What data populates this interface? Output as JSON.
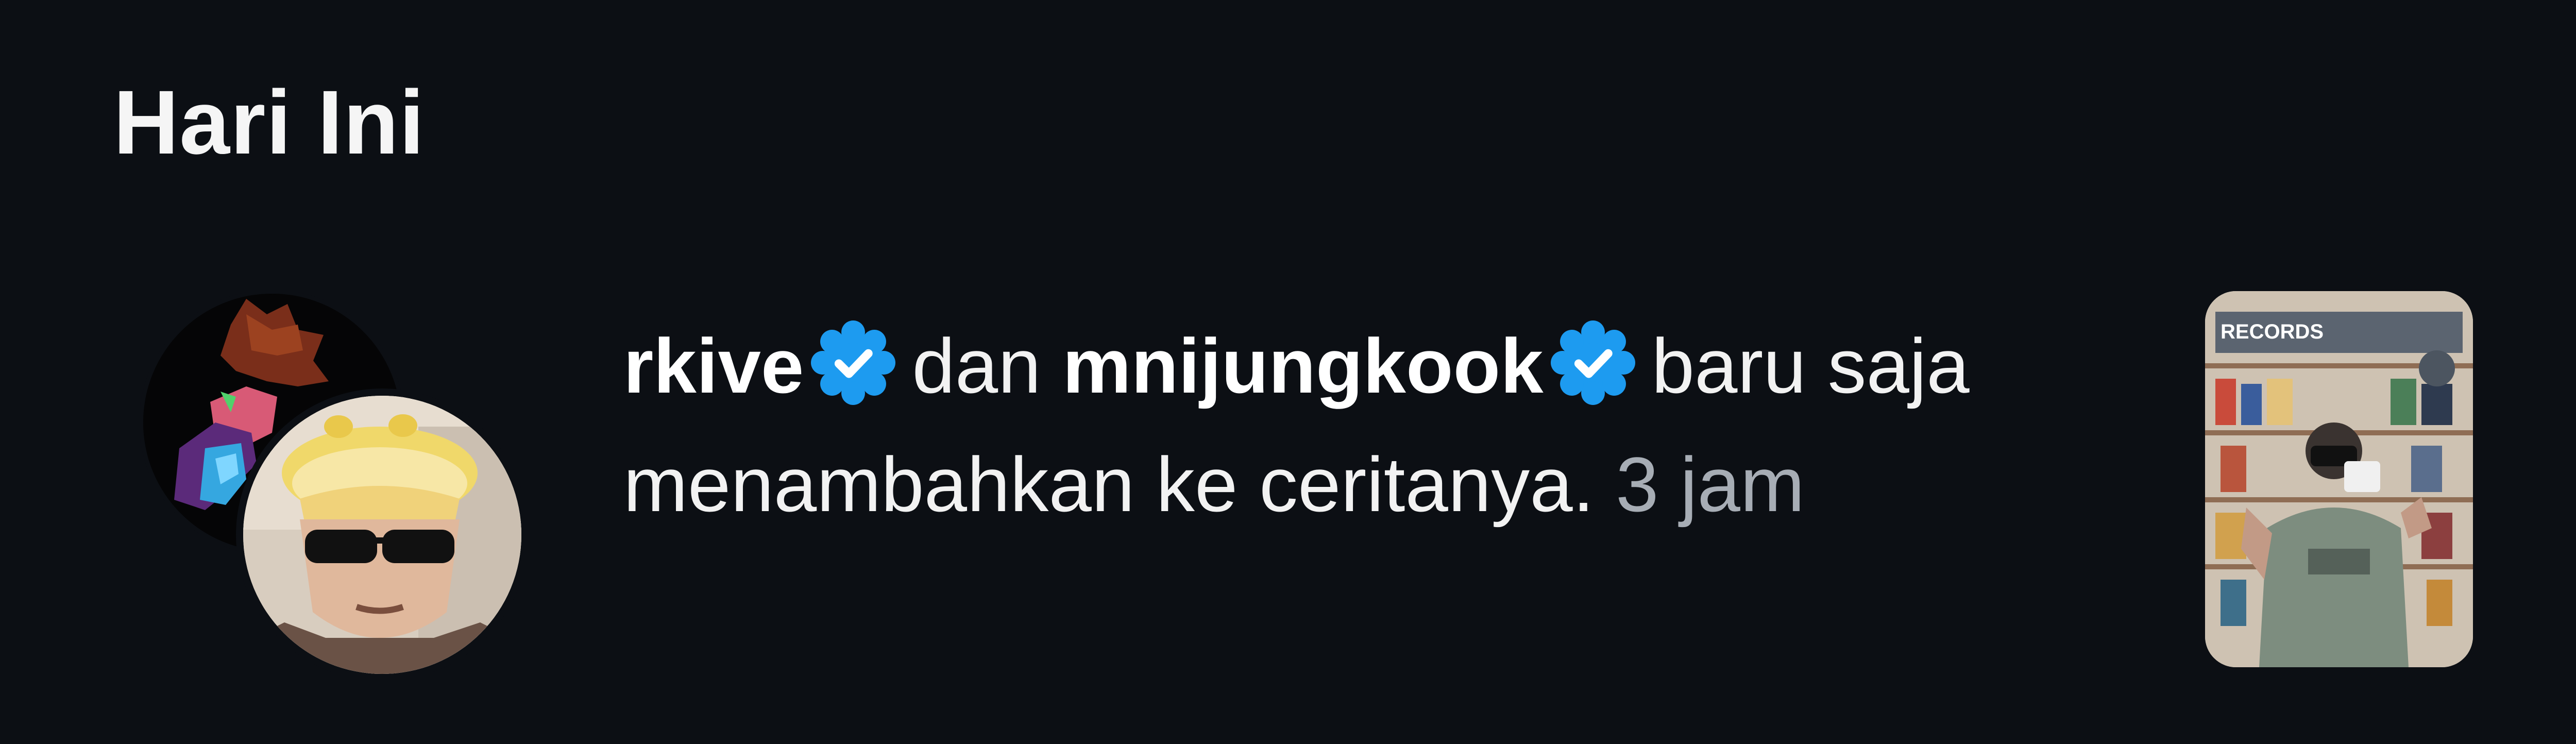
{
  "header": {
    "title": "Hari Ini"
  },
  "notification": {
    "user1": "rkive",
    "connector": "dan",
    "user2": "mnijungkook",
    "action": "baru saja menambahkan ke ceritanya.",
    "time": "3 jam",
    "avatar_back_icon": "stylized-character-avatar",
    "avatar_front_icon": "person-with-sunglasses-avatar",
    "story_thumbnail_icon": "record-store-photo-thumbnail",
    "verified_badge_icon": "verified-badge-icon"
  },
  "thumbnail": {
    "store_sign_text": "RECORDS"
  },
  "colors": {
    "background": "#0c0f14",
    "text_primary": "#f2f2f2",
    "text_secondary": "#a7adb5",
    "verified_blue": "#1d9bf0"
  }
}
